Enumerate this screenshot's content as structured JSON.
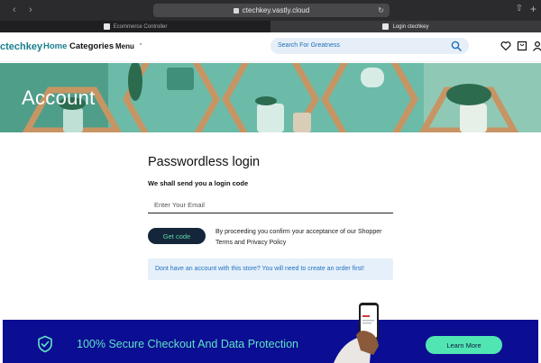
{
  "browser": {
    "url": "ctechkey.vastly.cloud",
    "tabs": [
      {
        "label": "Ecommerce Controller",
        "active": false
      },
      {
        "label": "Login ctechkey",
        "active": true
      }
    ]
  },
  "header": {
    "logo": "ctechkey",
    "nav": {
      "home": "Home",
      "categories": "Categories",
      "menu": "Menu"
    },
    "search_placeholder": "Search For Greatness",
    "icons": [
      "heart-icon",
      "cart-icon",
      "user-icon"
    ]
  },
  "hero": {
    "title": "Account"
  },
  "form": {
    "title": "Passwordless login",
    "subtitle": "We shall send you a login code",
    "email_placeholder": "Enter Your Email",
    "button": "Get code",
    "consent": "By proceeding you confirm your acceptance of our Shopper Terms and Privacy Policy",
    "notice": "Dont have an account with this store? You will need to create an order first!"
  },
  "banner": {
    "text": "100% Secure Checkout And Data Protection",
    "button": "Learn More"
  },
  "colors": {
    "brand": "#1a7f8c",
    "banner_bg": "#0b0d92",
    "banner_accent": "#5ee3c4",
    "button_dark": "#14263a"
  }
}
